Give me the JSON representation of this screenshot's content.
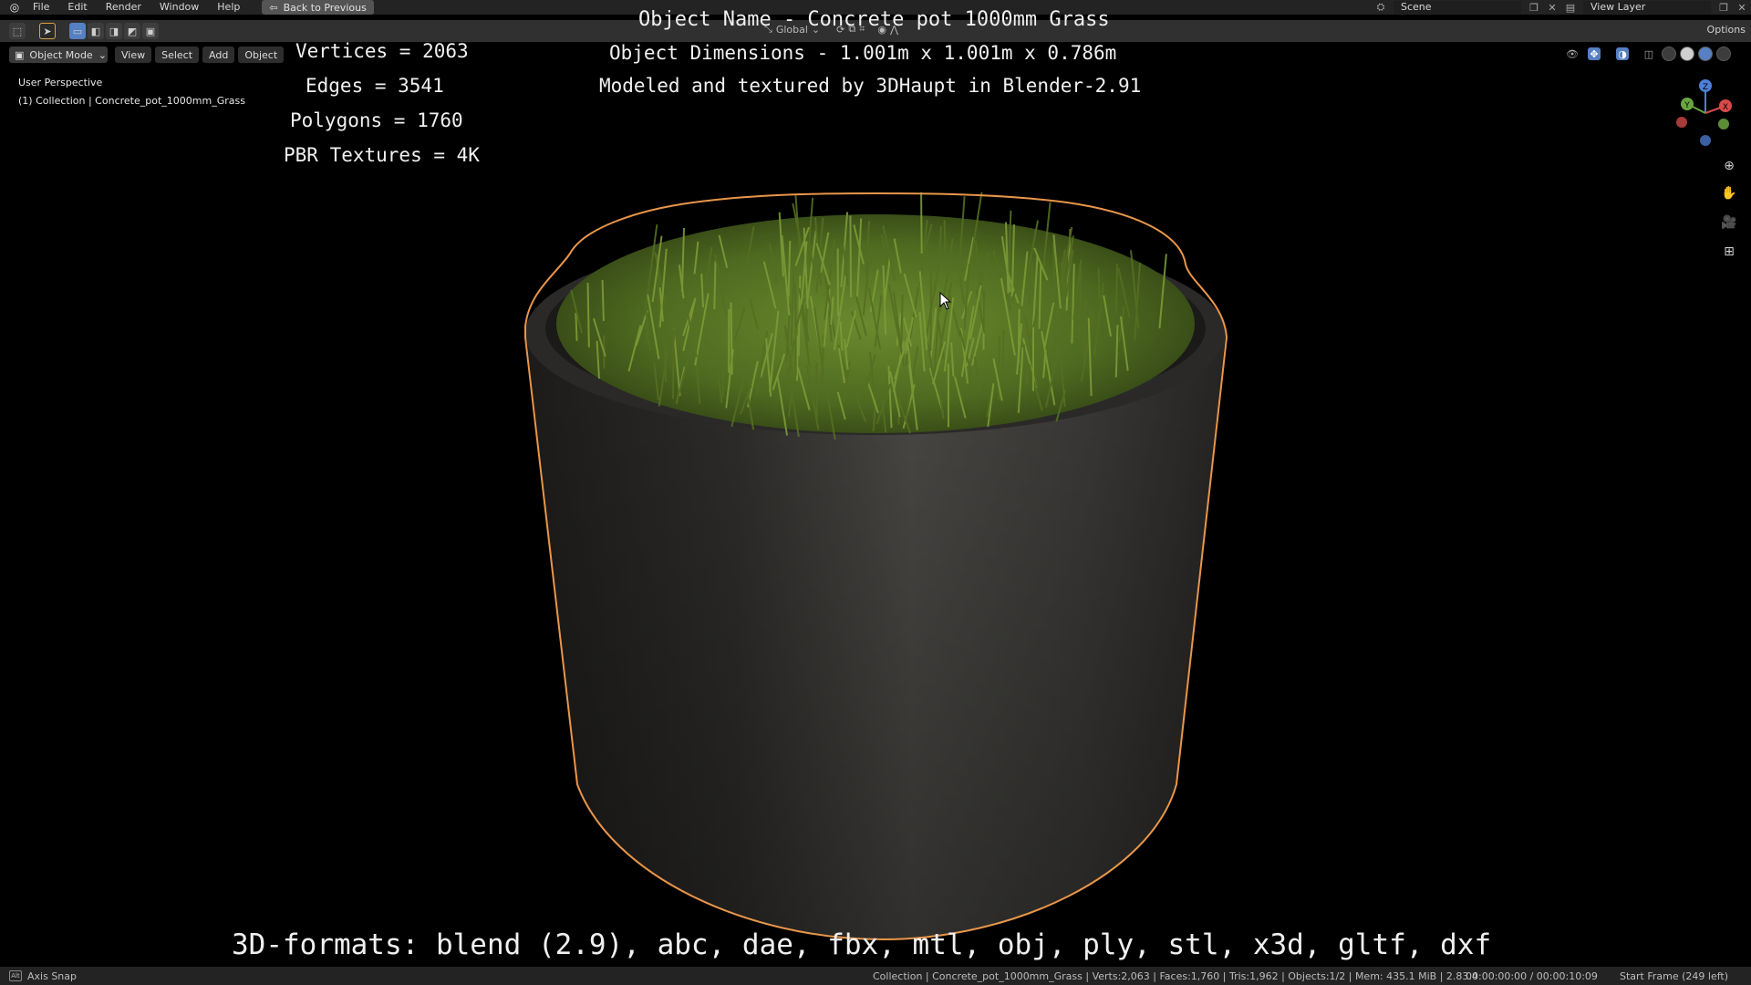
{
  "topbar": {
    "menu": [
      "File",
      "Edit",
      "Render",
      "Window",
      "Help"
    ],
    "back_label": "Back to Previous",
    "scene": "Scene",
    "view_layer": "View Layer"
  },
  "toolheader": {
    "orientation": "Global",
    "options": "Options"
  },
  "viewheader": {
    "mode": "Object Mode",
    "buttons": [
      "View",
      "Select",
      "Add",
      "Object"
    ]
  },
  "viewport": {
    "perspective": "User Perspective",
    "collection": "(1) Collection | Concrete_pot_1000mm_Grass",
    "stats": {
      "vertices": "Vertices = 2063",
      "edges": "Edges = 3541",
      "polygons": "Polygons = 1760",
      "textures": "PBR Textures = 4K"
    },
    "title": "Object Name - Concrete pot 1000mm Grass",
    "dimensions": "Object Dimensions -  1.001m x 1.001m x 0.786m",
    "credit": "Modeled and textured by 3DHaupt in Blender-2.91",
    "formats": "3D-formats: blend (2.9), abc, dae, fbx, mtl, obj, ply, stl, x3d, gltf, dxf"
  },
  "gizmo": {
    "axes": [
      "Z",
      "Y",
      "X"
    ]
  },
  "statusbar": {
    "axis_snap": "Axis Snap",
    "alt_key": "Alt",
    "stats": "Collection | Concrete_pot_1000mm_Grass | Verts:2,063 | Faces:1,760 | Tris:1,962 | Objects:1/2 | Mem: 435.1 MiB | 2.83.4",
    "time": "00:00:00:00 / 00:00:10:09",
    "frame": "Start Frame (249 left)"
  },
  "colors": {
    "outline": "#e8964a",
    "accent": "#5680c2",
    "grass": "#5d7a2a",
    "concrete": "#3f3e3c"
  }
}
